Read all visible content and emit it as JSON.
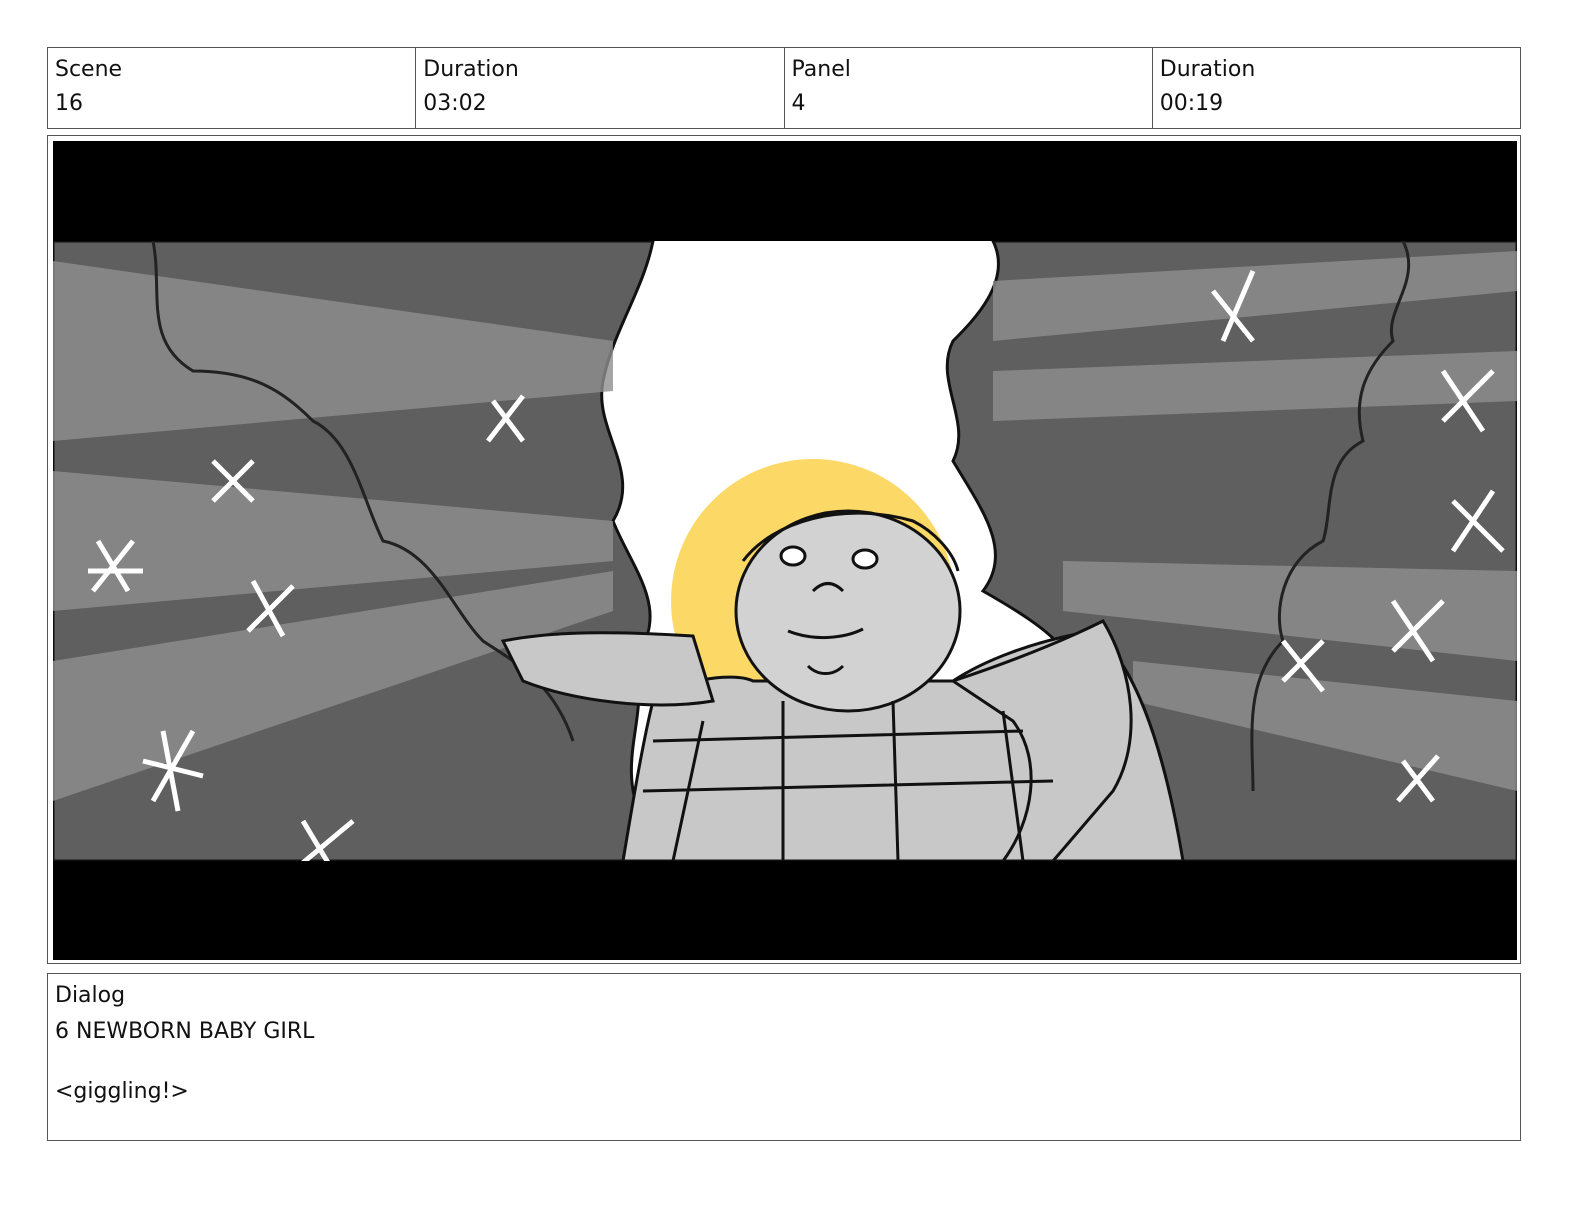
{
  "header": {
    "scene_label": "Scene",
    "scene_value": "16",
    "scene_duration_label": "Duration",
    "scene_duration_value": "03:02",
    "panel_label": "Panel",
    "panel_value": "4",
    "panel_duration_label": "Duration",
    "panel_duration_value": "00:19"
  },
  "dialog": {
    "label": "Dialog",
    "lines": [
      "6 NEWBORN BABY GIRL",
      "",
      "<giggling!>"
    ]
  },
  "colors": {
    "halo": "#fcd967",
    "letterbox": "#000000",
    "foliage_dark": "#5f5f5f",
    "foliage_light": "#8a8a8a",
    "sky": "#ffffff"
  }
}
